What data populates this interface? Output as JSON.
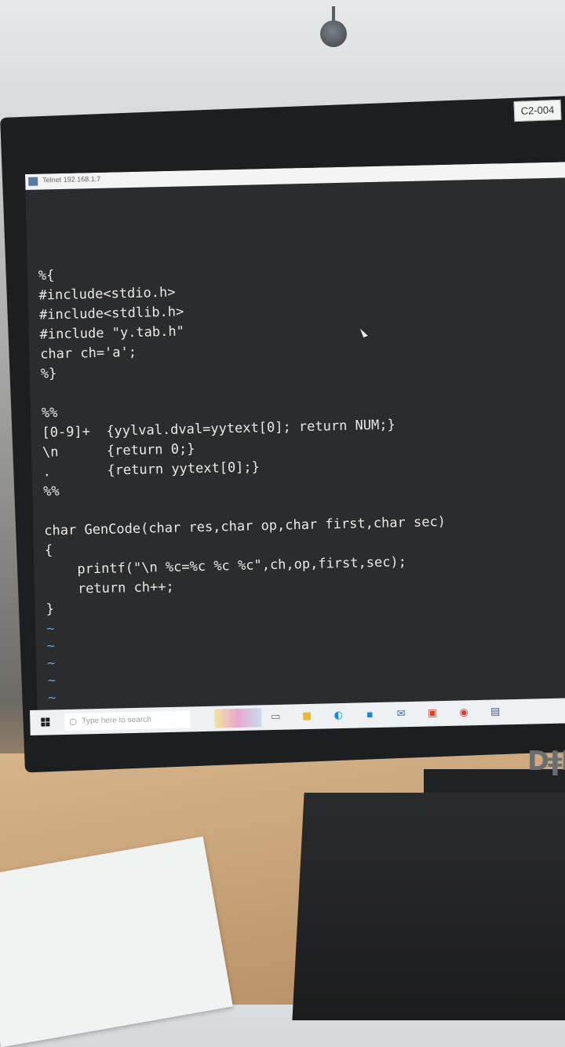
{
  "room": {
    "monitor_tag": "C2-004",
    "brand": "DELL"
  },
  "terminal": {
    "window_title": "Telnet 192.168.1.7",
    "code_lines": [
      "%{",
      "#include<stdio.h>",
      "#include<stdlib.h>",
      "#include \"y.tab.h\"",
      "char ch='a';",
      "%}",
      "",
      "%%",
      "[0-9]+  {yylval.dval=yytext[0]; return NUM;}",
      "\\n      {return 0;}",
      ".       {return yytext[0];}",
      "%%",
      "",
      "char GenCode(char res,char op,char first,char sec)",
      "{",
      "    printf(\"\\n %c=%c %c %c\",ch,op,first,sec);",
      "    return ch++;",
      "}"
    ],
    "tilde_lines": [
      "~",
      "~",
      "~",
      "~",
      "~",
      "~",
      "~"
    ]
  },
  "taskbar": {
    "search_placeholder": "Type here to search",
    "icons": [
      "start-icon",
      "task-view-icon",
      "file-explorer-icon",
      "edge-icon",
      "store-icon",
      "mail-icon",
      "powerpoint-icon",
      "chrome-icon",
      "network-icon"
    ]
  }
}
